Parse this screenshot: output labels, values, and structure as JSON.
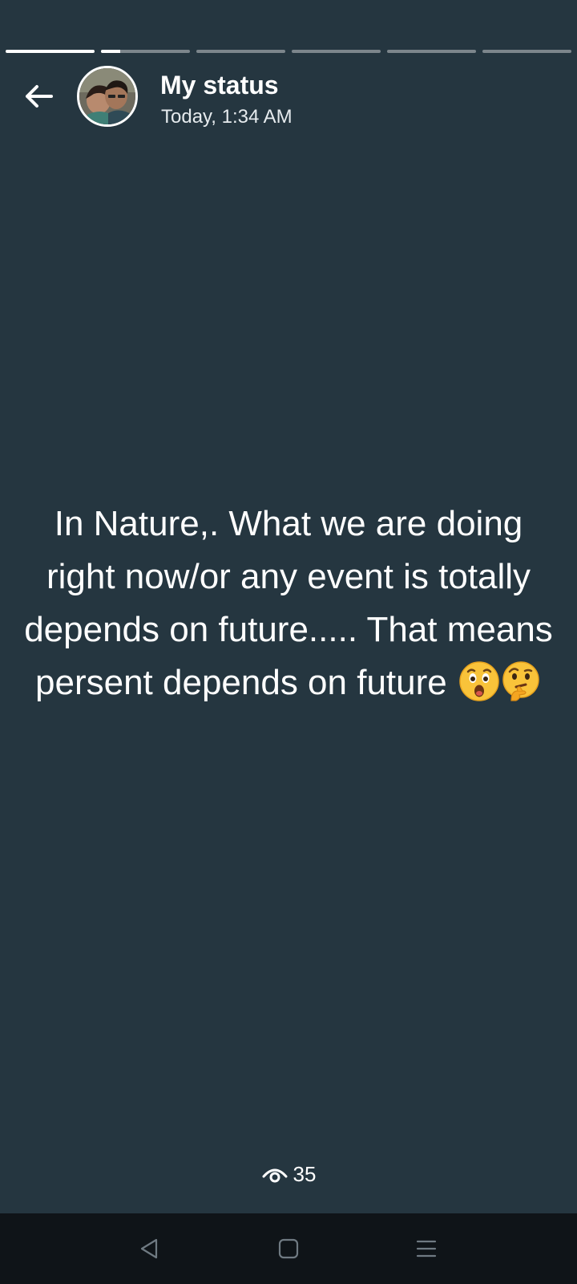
{
  "progress": {
    "segments": [
      1.0,
      0.22,
      0,
      0,
      0,
      0
    ]
  },
  "header": {
    "title": "My status",
    "timestamp": "Today, 1:34 AM"
  },
  "status": {
    "text": "In Nature,. What we are doing right now/or any event is totally depends on future..... That means persent depends on future",
    "emojis": [
      "astonished-face",
      "thinking-face"
    ]
  },
  "footer": {
    "views_count": "35"
  },
  "colors": {
    "background": "#253640",
    "navbar": "#0f1418",
    "accent": "#ffffff"
  },
  "icons": {
    "back": "arrow-left-icon",
    "views": "eye-icon",
    "nav_back": "triangle-back-icon",
    "nav_home": "square-home-icon",
    "nav_menu": "hamburger-menu-icon"
  }
}
